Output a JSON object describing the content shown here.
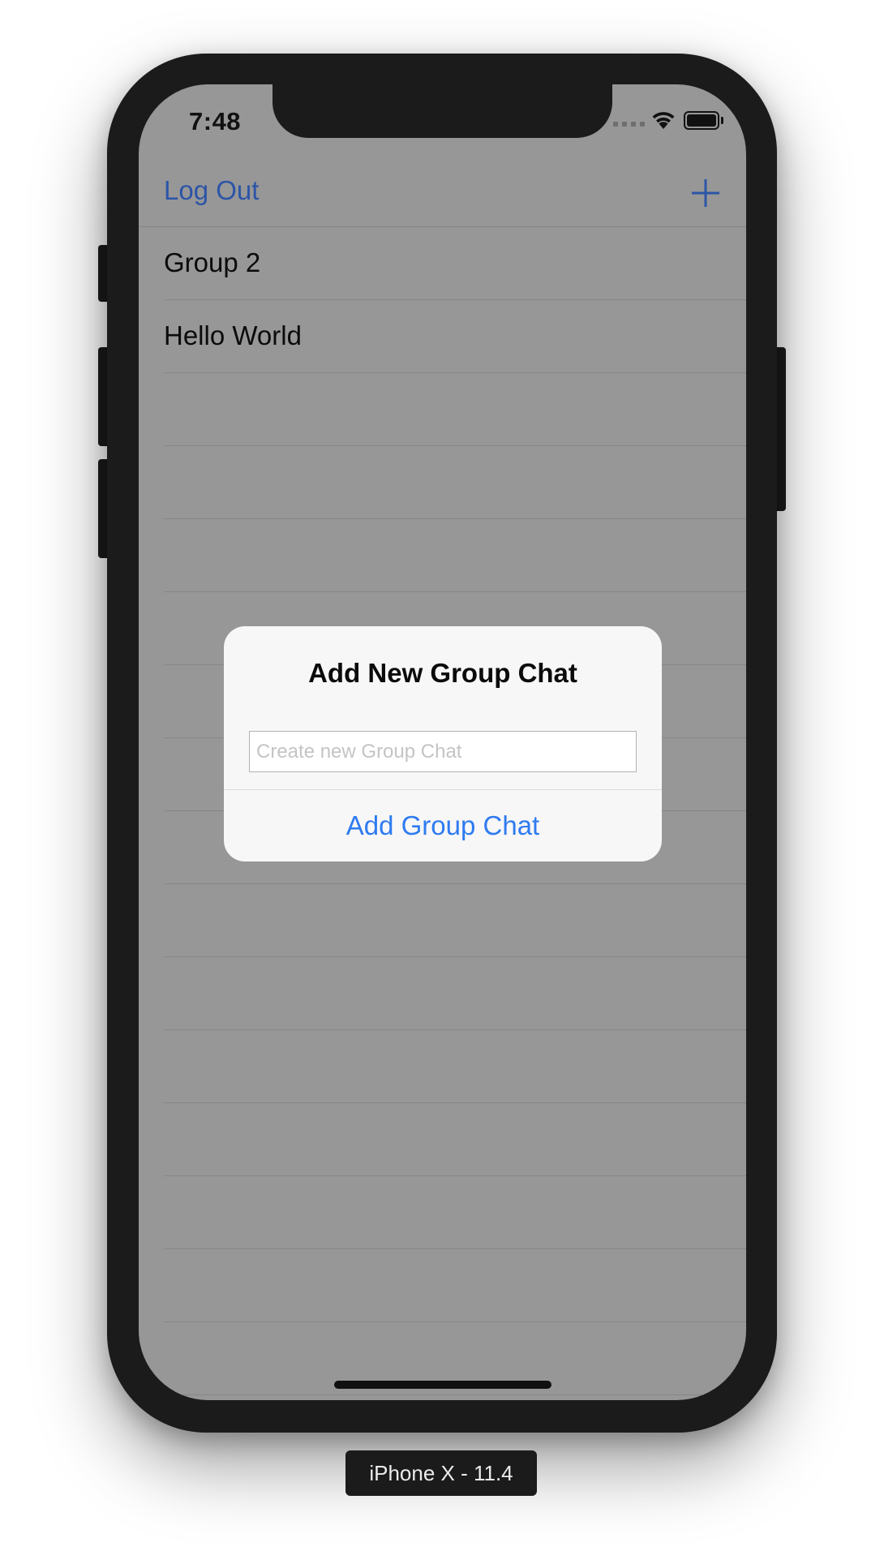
{
  "status_bar": {
    "time": "7:48"
  },
  "nav": {
    "left_button": "Log Out",
    "right_icon": "plus-icon"
  },
  "list": {
    "rows": [
      {
        "label": "Group 2"
      },
      {
        "label": "Hello World"
      },
      {
        "label": ""
      },
      {
        "label": ""
      },
      {
        "label": ""
      },
      {
        "label": ""
      },
      {
        "label": ""
      },
      {
        "label": ""
      },
      {
        "label": ""
      },
      {
        "label": ""
      },
      {
        "label": ""
      },
      {
        "label": ""
      },
      {
        "label": ""
      },
      {
        "label": ""
      },
      {
        "label": ""
      },
      {
        "label": ""
      },
      {
        "label": ""
      },
      {
        "label": ""
      }
    ]
  },
  "alert": {
    "title": "Add New Group Chat",
    "input_placeholder": "Create new Group Chat",
    "input_value": "",
    "action_label": "Add Group Chat"
  },
  "simulator": {
    "device_label": "iPhone X - 11.4"
  },
  "colors": {
    "accent": "#2c55a7",
    "alert_button": "#2f7bf0",
    "dim_background": "#979797"
  }
}
